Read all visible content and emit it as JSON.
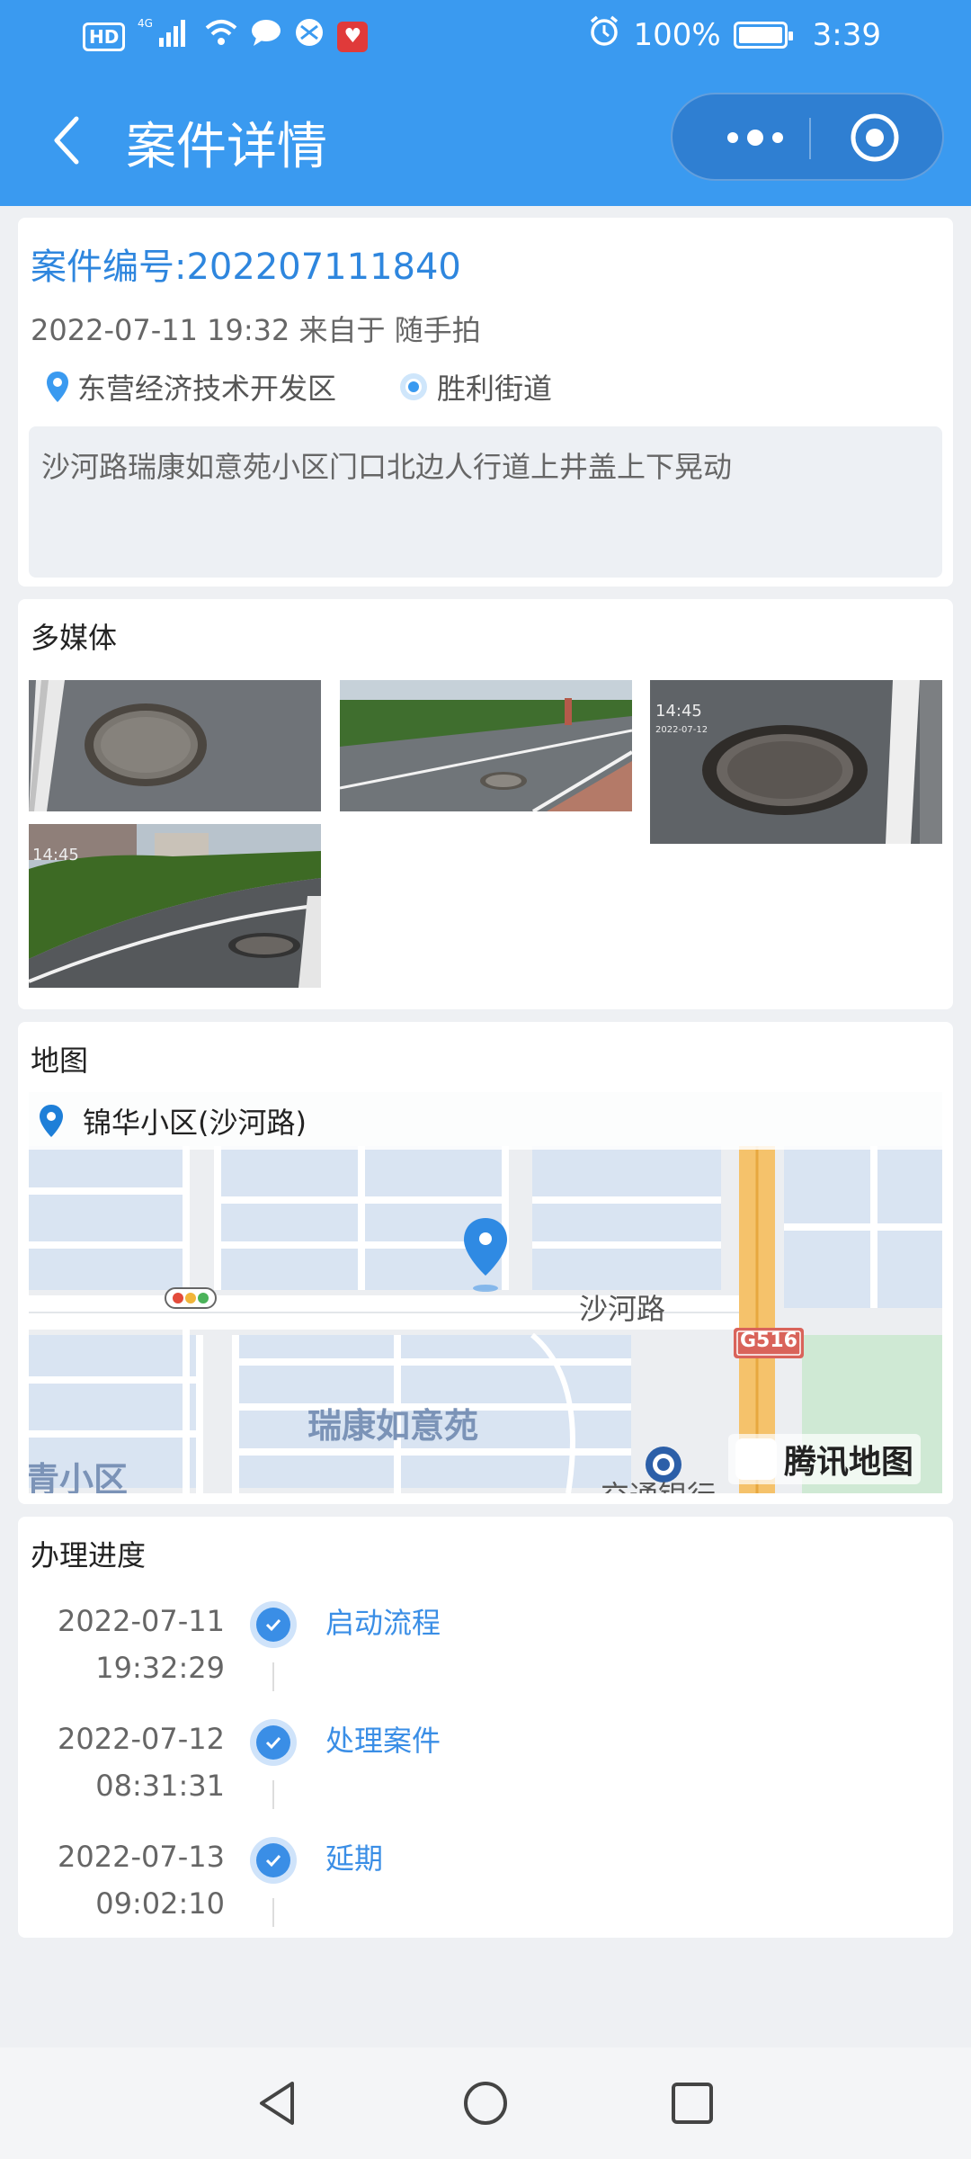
{
  "status_bar": {
    "network_badge": "HD",
    "signal_label": "4G",
    "battery_percent": "100%",
    "time": "3:39",
    "colors": {
      "bar_text": "#ffffff"
    }
  },
  "nav": {
    "title": "案件详情",
    "back_icon": "chevron-left-icon",
    "more_icon": "more-dots-icon",
    "close_icon": "target-close-icon"
  },
  "case": {
    "number_label": "案件编号:202207111840",
    "meta": "2022-07-11 19:32 来自于 随手拍",
    "district": "东营经济技术开发区",
    "street": "胜利街道",
    "description": "沙河路瑞康如意苑小区门口北边人行道上井盖上下晃动"
  },
  "media": {
    "title": "多媒体",
    "photos": [
      {
        "kind": "manhole-closeup",
        "overlay_time": ""
      },
      {
        "kind": "street-sidewalk",
        "overlay_time": ""
      },
      {
        "kind": "manhole-road",
        "overlay_time": "14:45",
        "overlay_date": "2022-07-12"
      },
      {
        "kind": "hedge-road",
        "overlay_time": "14:45",
        "overlay_date": ""
      }
    ]
  },
  "map": {
    "title": "地图",
    "place_name": "锦华小区(沙河路)",
    "road_label": "沙河路",
    "highway_badge": "G516",
    "area_label": "瑞康如意苑",
    "corner_label": "青小区",
    "bank_label": "交通银行",
    "brand": "腾讯地图"
  },
  "progress": {
    "title": "办理进度",
    "steps": [
      {
        "date": "2022-07-11",
        "time": "19:32:29",
        "label": "启动流程"
      },
      {
        "date": "2022-07-12",
        "time": "08:31:31",
        "label": "处理案件"
      },
      {
        "date": "2022-07-13",
        "time": "09:02:10",
        "label": "延期"
      }
    ]
  },
  "system_nav": {
    "back_icon": "triangle-back-icon",
    "home_icon": "circle-home-icon",
    "recents_icon": "square-recents-icon"
  },
  "colors": {
    "brand_blue": "#3a9af0",
    "link_blue": "#2e86de",
    "page_bg": "#eef0f3"
  }
}
